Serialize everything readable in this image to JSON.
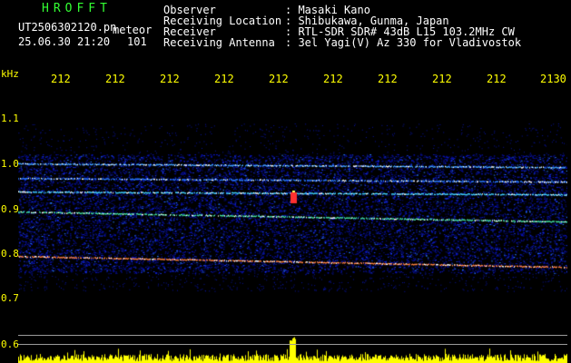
{
  "header": {
    "brand": "HROFFT",
    "file": "UT2506302120.pn",
    "meteor_label": "meteor",
    "date": "25.06.30 21:20",
    "count": "101",
    "fields": [
      {
        "label": "Observer",
        "value": ": Masaki Kano"
      },
      {
        "label": "Receiving Location",
        "value": ": Shibukawa, Gunma, Japan"
      },
      {
        "label": "Receiver",
        "value": ": RTL-SDR SDR# 43dB L15 103.2MHz CW"
      },
      {
        "label": "Receiving Antenna",
        "value": ": 3el Yagi(V) Az 330 for Vladivostok"
      }
    ]
  },
  "axis": {
    "unit": "kHz",
    "y_ticks": [
      "1.1",
      "1.0",
      "0.9",
      "0.8",
      "0.7",
      "0.6"
    ],
    "x_ticks": [
      "212",
      "212",
      "212",
      "212",
      "212",
      "212",
      "212",
      "212",
      "212",
      "2130"
    ]
  },
  "colors": {
    "background": "#000000",
    "tick_color": "#ffff00",
    "brand_color": "#33ff33",
    "waterfall_base": "#000080",
    "activity_color": "#ffff00"
  }
}
